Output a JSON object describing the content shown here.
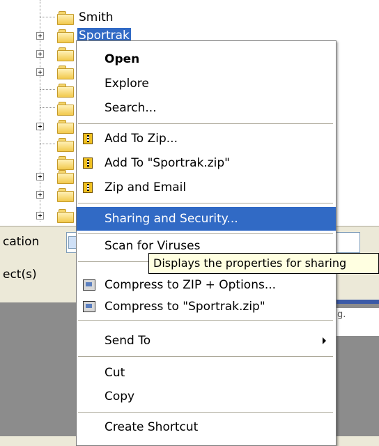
{
  "tree": {
    "items": [
      {
        "label": "Smith",
        "expandable": false
      },
      {
        "label": "Sportrak",
        "expandable": true,
        "selected": true
      },
      {
        "label": "",
        "expandable": true
      },
      {
        "label": "",
        "expandable": true
      },
      {
        "label": "",
        "expandable": false
      },
      {
        "label": "",
        "expandable": false
      },
      {
        "label": "",
        "expandable": true
      },
      {
        "label": "",
        "expandable": false
      },
      {
        "label": "",
        "expandable": true
      },
      {
        "label": "",
        "expandable": true
      },
      {
        "label": "",
        "expandable": true
      }
    ]
  },
  "address_bar": {
    "label": "cation"
  },
  "tabs_row": {
    "label": "ect(s)"
  },
  "lower_strip": {
    "text": "g."
  },
  "context_menu": {
    "open": "Open",
    "explore": "Explore",
    "search": "Search...",
    "add_to_zip": "Add To Zip...",
    "add_to_named_zip": "Add To \"Sportrak.zip\"",
    "zip_and_email": "Zip and Email",
    "sharing_security": "Sharing and Security...",
    "scan_viruses": "Scan for Viruses",
    "compress_zip_options": "Compress to ZIP + Options...",
    "compress_named_zip": "Compress to \"Sportrak.zip\"",
    "send_to": "Send To",
    "cut": "Cut",
    "copy": "Copy",
    "create_shortcut": "Create Shortcut"
  },
  "tooltip": {
    "text": "Displays the properties for sharing"
  },
  "colors": {
    "highlight": "#316ac5",
    "tooltip_bg": "#ffffe1"
  }
}
